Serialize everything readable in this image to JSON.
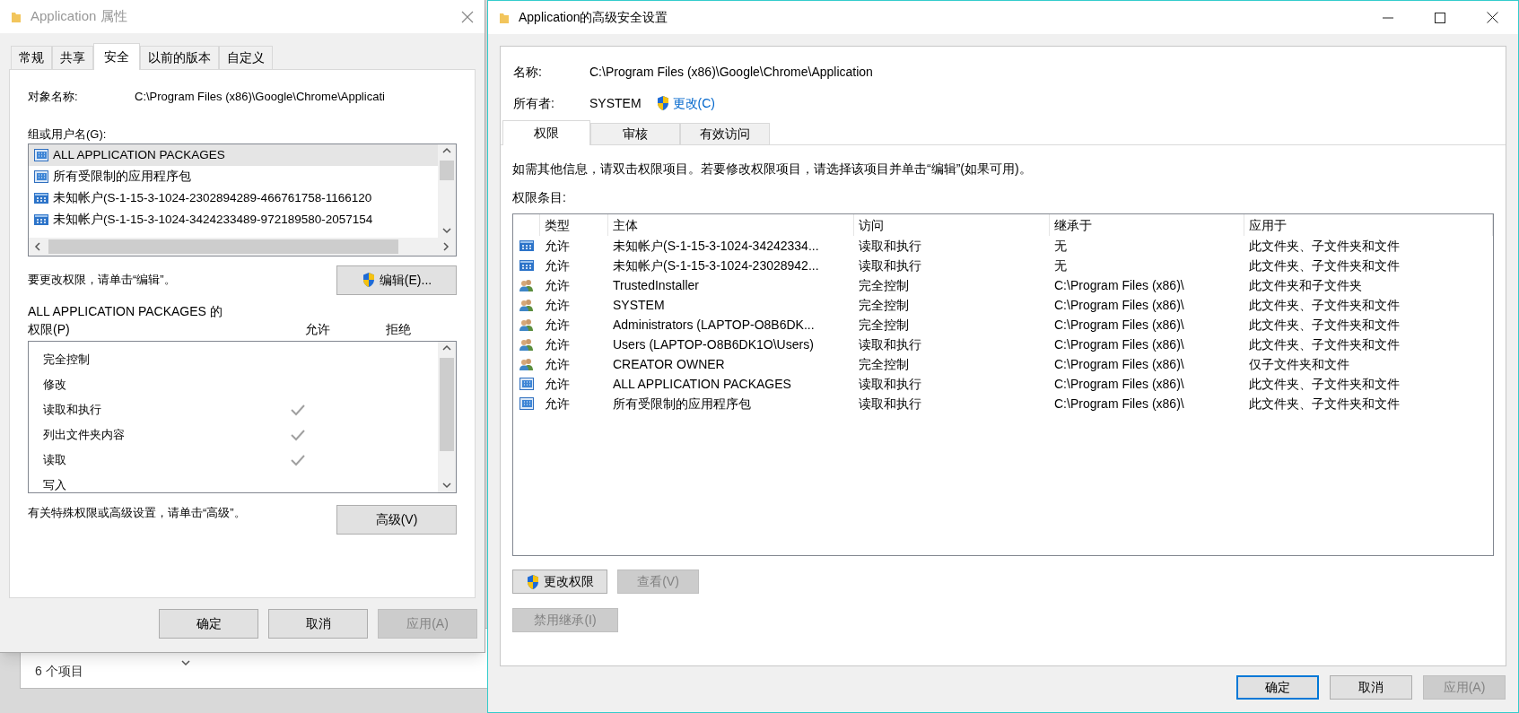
{
  "properties_window": {
    "title": "Application 属性",
    "tabs": [
      {
        "label": "常规",
        "selected": false
      },
      {
        "label": "共享",
        "selected": false
      },
      {
        "label": "安全",
        "selected": true
      },
      {
        "label": "以前的版本",
        "selected": false
      },
      {
        "label": "自定义",
        "selected": false
      }
    ],
    "object_name_label": "对象名称:",
    "object_name": "C:\\Program Files (x86)\\Google\\Chrome\\Applicati",
    "groups_label": "组或用户名(G):",
    "groups": [
      {
        "kind": "package",
        "name": "ALL APPLICATION PACKAGES",
        "selected": true
      },
      {
        "kind": "package",
        "name": "所有受限制的应用程序包",
        "selected": false
      },
      {
        "kind": "unknown",
        "name": "未知帐户(S-1-15-3-1024-2302894289-466761758-1166120",
        "selected": false
      },
      {
        "kind": "unknown",
        "name": "未知帐户(S-1-15-3-1024-3424233489-972189580-2057154",
        "selected": false
      }
    ],
    "edit_hint": "要更改权限，请单击“编辑”。",
    "edit_button": "编辑(E)...",
    "permissions_title": "ALL APPLICATION PACKAGES 的",
    "permissions_label": "权限(P)",
    "allow_header": "允许",
    "deny_header": "拒绝",
    "permissions": [
      {
        "name": "完全控制",
        "allow": false,
        "deny": false
      },
      {
        "name": "修改",
        "allow": false,
        "deny": false
      },
      {
        "name": "读取和执行",
        "allow": true,
        "deny": false
      },
      {
        "name": "列出文件夹内容",
        "allow": true,
        "deny": false
      },
      {
        "name": "读取",
        "allow": true,
        "deny": false
      },
      {
        "name": "写入",
        "allow": false,
        "deny": false
      }
    ],
    "advanced_hint": "有关特殊权限或高级设置，请单击“高级”。",
    "advanced_button": "高级(V)",
    "buttons": [
      {
        "label": "确定",
        "disabled": false
      },
      {
        "label": "取消",
        "disabled": false
      },
      {
        "label": "应用(A)",
        "disabled": true
      }
    ]
  },
  "background_window": {
    "status": "6 个项目"
  },
  "advanced_window": {
    "title": "Application的高级安全设置",
    "name_label": "名称:",
    "name": "C:\\Program Files (x86)\\Google\\Chrome\\Application",
    "owner_label": "所有者:",
    "owner": "SYSTEM",
    "change_link": "更改(C)",
    "tabs": [
      {
        "label": "权限",
        "selected": true
      },
      {
        "label": "审核",
        "selected": false
      },
      {
        "label": "有效访问",
        "selected": false
      }
    ],
    "info": "如需其他信息，请双击权限项目。若要修改权限项目，请选择该项目并单击“编辑”(如果可用)。",
    "entries_label": "权限条目:",
    "table": {
      "columns": [
        "类型",
        "主体",
        "访问",
        "继承于",
        "应用于"
      ],
      "rows": [
        {
          "kind": "unknown",
          "cells": [
            "允许",
            "未知帐户(S-1-15-3-1024-34242334...",
            "读取和执行",
            "无",
            "此文件夹、子文件夹和文件"
          ]
        },
        {
          "kind": "unknown",
          "cells": [
            "允许",
            "未知帐户(S-1-15-3-1024-23028942...",
            "读取和执行",
            "无",
            "此文件夹、子文件夹和文件"
          ]
        },
        {
          "kind": "user",
          "cells": [
            "允许",
            "TrustedInstaller",
            "完全控制",
            "C:\\Program Files (x86)\\",
            "此文件夹和子文件夹"
          ]
        },
        {
          "kind": "user",
          "cells": [
            "允许",
            "SYSTEM",
            "完全控制",
            "C:\\Program Files (x86)\\",
            "此文件夹、子文件夹和文件"
          ]
        },
        {
          "kind": "user",
          "cells": [
            "允许",
            "Administrators (LAPTOP-O8B6DK...",
            "完全控制",
            "C:\\Program Files (x86)\\",
            "此文件夹、子文件夹和文件"
          ]
        },
        {
          "kind": "user",
          "cells": [
            "允许",
            "Users (LAPTOP-O8B6DK1O\\Users)",
            "读取和执行",
            "C:\\Program Files (x86)\\",
            "此文件夹、子文件夹和文件"
          ]
        },
        {
          "kind": "user",
          "cells": [
            "允许",
            "CREATOR OWNER",
            "完全控制",
            "C:\\Program Files (x86)\\",
            "仅子文件夹和文件"
          ]
        },
        {
          "kind": "package",
          "cells": [
            "允许",
            "ALL APPLICATION PACKAGES",
            "读取和执行",
            "C:\\Program Files (x86)\\",
            "此文件夹、子文件夹和文件"
          ]
        },
        {
          "kind": "package",
          "cells": [
            "允许",
            "所有受限制的应用程序包",
            "读取和执行",
            "C:\\Program Files (x86)\\",
            "此文件夹、子文件夹和文件"
          ]
        }
      ]
    },
    "action_buttons": [
      {
        "label": "更改权限",
        "shield": true,
        "disabled": false
      },
      {
        "label": "查看(V)",
        "shield": false,
        "disabled": true
      }
    ],
    "inheritance_button": {
      "label": "禁用继承(I)",
      "disabled": true
    },
    "buttons": [
      {
        "label": "确定",
        "disabled": false,
        "focused": true
      },
      {
        "label": "取消",
        "disabled": false,
        "focused": false
      },
      {
        "label": "应用(A)",
        "disabled": true,
        "focused": false
      }
    ]
  }
}
